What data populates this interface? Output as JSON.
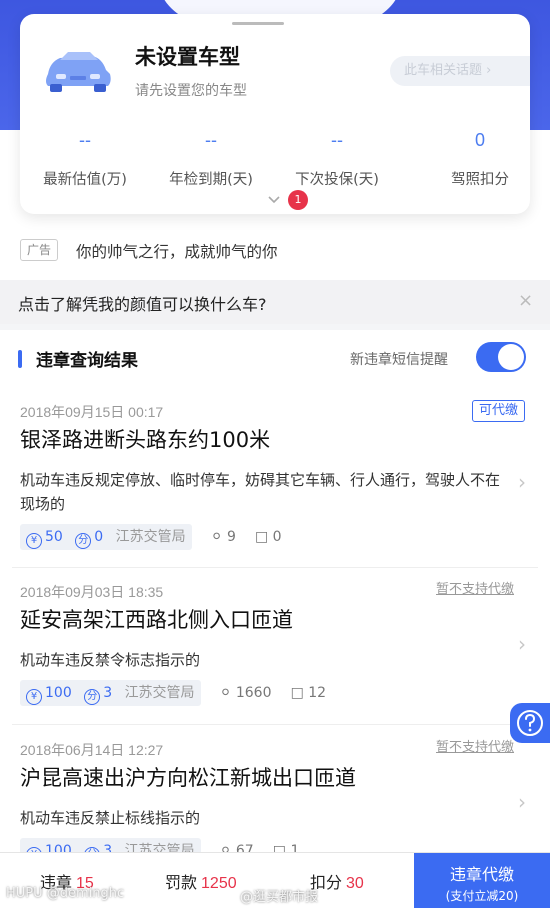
{
  "car_card": {
    "title": "未设置车型",
    "subtitle": "请先设置您的车型",
    "topic_button": "此车相关话题 ›",
    "stats": [
      {
        "value": "--",
        "label": "最新估值(万)"
      },
      {
        "value": "--",
        "label": "年检到期(天)"
      },
      {
        "value": "--",
        "label": "下次投保(天)"
      },
      {
        "value": "0",
        "label": "驾照扣分"
      }
    ],
    "expand_icon": "chevron-down-icon",
    "badge_count": "1"
  },
  "ad": {
    "tag": "广告",
    "text": "你的帅气之行，成就帅气的你"
  },
  "promo": {
    "text": "点击了解凭我的颜值可以换什么车?",
    "close_icon": "×"
  },
  "violations": {
    "section_title": "违章查询结果",
    "sms_label": "新违章短信提醒",
    "sms_enabled": true,
    "items": [
      {
        "date": "2018年09月15日 00:17",
        "pay_status": "可代缴",
        "place": "银泽路进断头路东约100米",
        "description": "机动车违反规定停放、临时停车，妨碍其它车辆、行人通行，驾驶人不在现场的",
        "fine": "50",
        "points": "0",
        "authority": "江苏交管局",
        "views": "9",
        "comments": "0"
      },
      {
        "date": "2018年09月03日 18:35",
        "pay_status": "暂不支持代缴",
        "place": "延安高架江西路北侧入口匝道",
        "description": "机动车违反禁令标志指示的",
        "fine": "100",
        "points": "3",
        "authority": "江苏交管局",
        "views": "1660",
        "comments": "12"
      },
      {
        "date": "2018年06月14日 12:27",
        "pay_status": "暂不支持代缴",
        "place": "沪昆高速出沪方向松江新城出口匝道",
        "description": "机动车违反禁止标线指示的",
        "fine": "100",
        "points": "3",
        "authority": "江苏交管局",
        "views": "67",
        "comments": "1"
      }
    ],
    "coin_glyph": "¥",
    "points_glyph": "分"
  },
  "bottom_bar": {
    "violations_label": "违章",
    "violations_count": "15",
    "fines_label": "罚款",
    "fines_amount": "1250",
    "points_label": "扣分",
    "points_total": "30",
    "agent_label": "违章代缴",
    "agent_sub": "(支付立减20)"
  },
  "watermarks": {
    "left": "HUPU @deminghc",
    "center": "@逛买都市报"
  },
  "colors": {
    "accent": "#3b6bf2",
    "header": "#4b66ea",
    "alert": "#e7334a"
  }
}
